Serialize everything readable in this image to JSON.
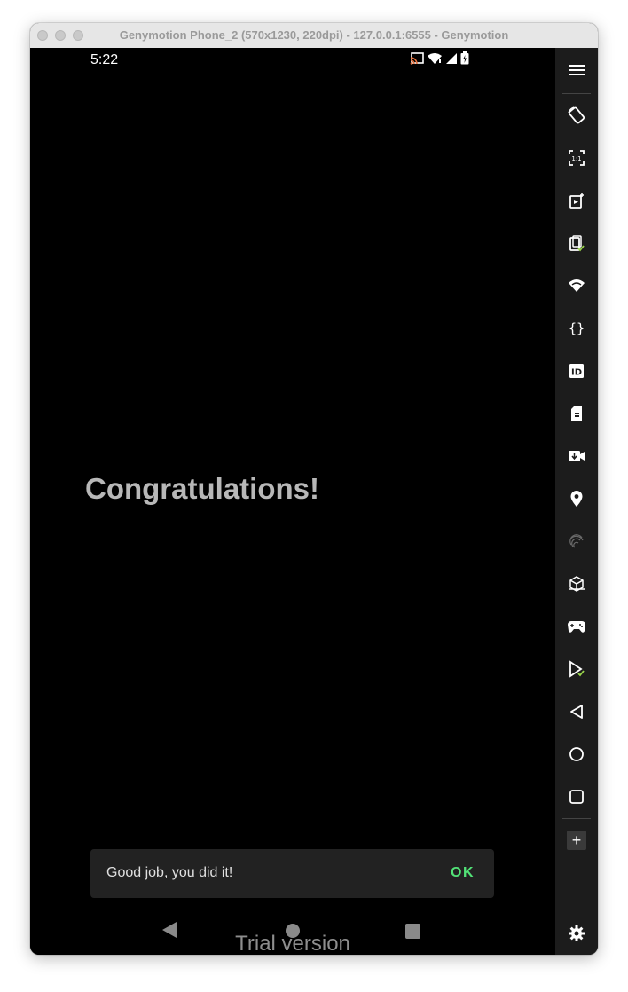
{
  "window": {
    "title": "Genymotion Phone_2 (570x1230, 220dpi) - 127.0.0.1:6555 - Genymotion"
  },
  "status_bar": {
    "time": "5:22",
    "icons": [
      "cast-icon",
      "wifi-icon",
      "signal-icon",
      "battery-icon"
    ]
  },
  "app": {
    "heading": "Congratulations!"
  },
  "snackbar": {
    "message": "Good job, you did it!",
    "action": "OK",
    "action_color": "#52e277"
  },
  "nav_bar": {
    "buttons": [
      "back",
      "home",
      "recents"
    ]
  },
  "watermark": "Trial version",
  "sidebar": {
    "tools": [
      "menu-icon",
      "rotate-icon",
      "pixel-perfect-icon",
      "screen-record-icon",
      "clipboard-icon",
      "wifi-icon",
      "code-braces-icon",
      "device-id-icon",
      "sim-card-icon",
      "camera-icon",
      "location-pin-icon",
      "fingerprint-icon",
      "motion-sensor-icon",
      "gamepad-icon",
      "play-store-icon",
      "back-icon",
      "home-icon",
      "recents-icon",
      "plus-icon",
      "settings-icon"
    ]
  }
}
